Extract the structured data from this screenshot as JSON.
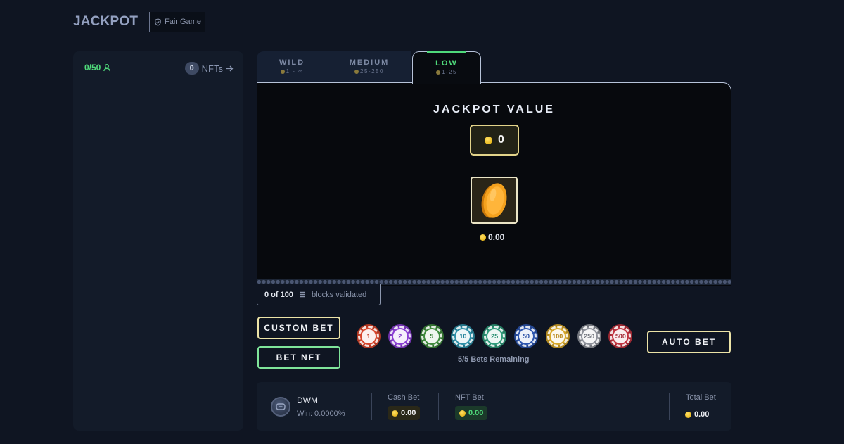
{
  "header": {
    "title": "JACKPOT",
    "fair_badge": "Fair Game"
  },
  "left_panel": {
    "players": "0/50",
    "nft_count": "0",
    "nfts_label": "NFTs"
  },
  "tabs": [
    {
      "label": "WILD",
      "range": "1 - ∞",
      "active": false
    },
    {
      "label": "MEDIUM",
      "range": "25-250",
      "active": false
    },
    {
      "label": "LOW",
      "range": "1-25",
      "active": true
    }
  ],
  "jackpot": {
    "title": "JACKPOT VALUE",
    "value": "0",
    "coin_amount": "0.00"
  },
  "blocks": {
    "count": "0 of 100",
    "label": "blocks validated"
  },
  "controls": {
    "custom_bet": "CUSTOM BET",
    "bet_nft": "BET NFT",
    "auto_bet": "AUTO BET",
    "remaining": "5/5 Bets Remaining"
  },
  "chips": [
    {
      "value": "1",
      "color": "#d6452b",
      "text_color": "#c23a20"
    },
    {
      "value": "2",
      "color": "#8a3fd3",
      "text_color": "#7a2ec8"
    },
    {
      "value": "5",
      "color": "#3f8a3c",
      "text_color": "#2f7a2c"
    },
    {
      "value": "10",
      "color": "#2d8fa8",
      "text_color": "#1d7f98"
    },
    {
      "value": "25",
      "color": "#2f9a7a",
      "text_color": "#1f8a6a"
    },
    {
      "value": "50",
      "color": "#2d56b0",
      "text_color": "#1d46a0"
    },
    {
      "value": "100",
      "color": "#d7a72a",
      "text_color": "#b7871a"
    },
    {
      "value": "250",
      "color": "#8d9099",
      "text_color": "#6d7079"
    },
    {
      "value": "500",
      "color": "#c0323f",
      "text_color": "#a0222f"
    }
  ],
  "summary": {
    "user_name": "DWM",
    "win_text": "Win: 0.0000%",
    "cash_label": "Cash Bet",
    "cash_value": "0.00",
    "nft_label": "NFT Bet",
    "nft_value": "0.00",
    "total_label": "Total Bet",
    "total_value": "0.00"
  },
  "colors": {
    "accent_green": "#4fd97a",
    "accent_gold": "#ece3a7",
    "background": "#0f1522"
  }
}
